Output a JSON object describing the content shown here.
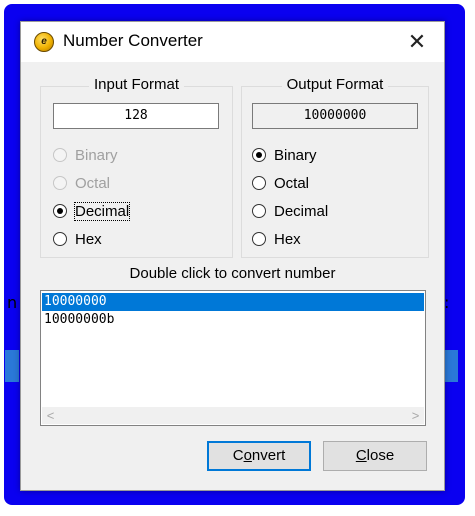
{
  "window": {
    "title": "Number Converter",
    "close_glyph": "✕",
    "icon": "app-logo-icon"
  },
  "input_format": {
    "label": "Input Format",
    "value": "128",
    "options": [
      {
        "label": "Binary",
        "selected": false,
        "enabled": false
      },
      {
        "label": "Octal",
        "selected": false,
        "enabled": false
      },
      {
        "label": "Decimal",
        "selected": true,
        "enabled": true
      },
      {
        "label": "Hex",
        "selected": false,
        "enabled": true
      }
    ]
  },
  "output_format": {
    "label": "Output Format",
    "value": "10000000",
    "options": [
      {
        "label": "Binary",
        "selected": true
      },
      {
        "label": "Octal",
        "selected": false
      },
      {
        "label": "Decimal",
        "selected": false
      },
      {
        "label": "Hex",
        "selected": false
      }
    ]
  },
  "results": {
    "hint": "Double click to convert number",
    "items": [
      "10000000",
      "10000000b"
    ],
    "selected_index": 0
  },
  "buttons": {
    "convert": {
      "label": "Convert",
      "mnemonic": "o"
    },
    "close": {
      "label": "Close",
      "mnemonic": "C"
    }
  },
  "colors": {
    "frame": "#0a00f0",
    "selection": "#0078d7",
    "default_button_border": "#0078d7"
  }
}
